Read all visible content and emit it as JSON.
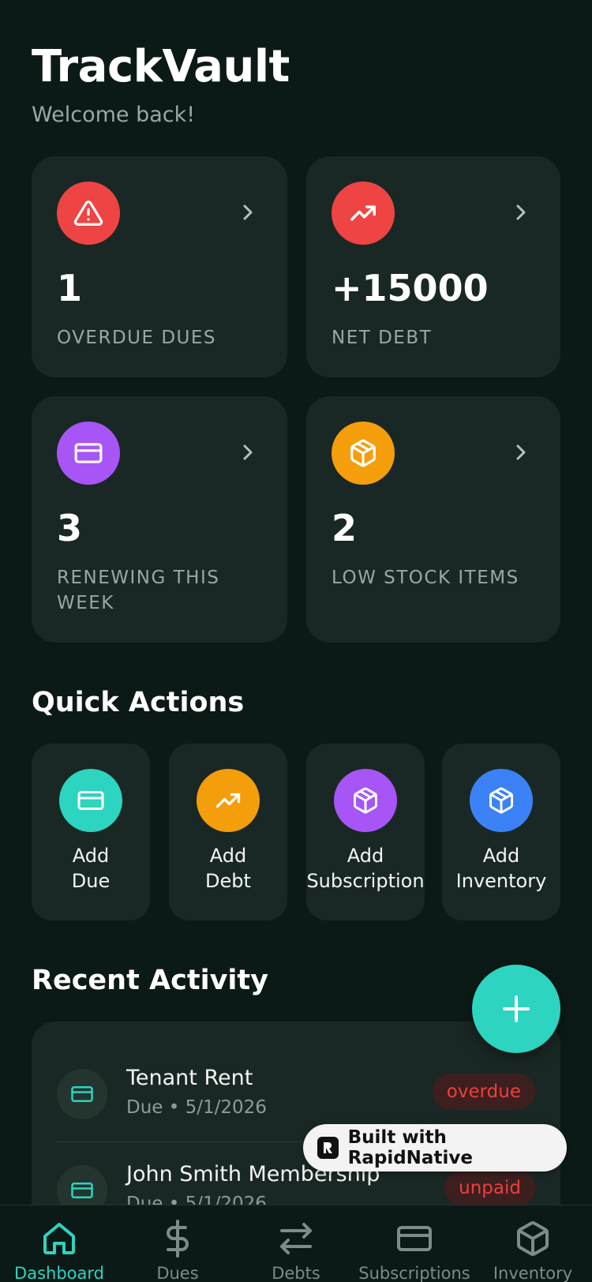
{
  "header": {
    "title": "TrackVault",
    "subtitle": "Welcome back!"
  },
  "stats": [
    {
      "value": "1",
      "label": "OVERDUE DUES",
      "icon": "alert-triangle-icon",
      "color": "#ef4444"
    },
    {
      "value": "+15000",
      "label": "NET DEBT",
      "icon": "trending-up-icon",
      "color": "#ef4444"
    },
    {
      "value": "3",
      "label": "RENEWING THIS WEEK",
      "icon": "credit-card-icon",
      "color": "#a855f7"
    },
    {
      "value": "2",
      "label": "LOW STOCK ITEMS",
      "icon": "package-icon",
      "color": "#f59e0b"
    }
  ],
  "quick_actions": {
    "title": "Quick Actions",
    "items": [
      {
        "label_line1": "Add",
        "label_line2": "Due",
        "icon": "credit-card-icon",
        "color": "#2dd4bf"
      },
      {
        "label_line1": "Add",
        "label_line2": "Debt",
        "icon": "trending-up-icon",
        "color": "#f59e0b"
      },
      {
        "label_line1": "Add",
        "label_line2": "Subscription",
        "icon": "package-icon",
        "color": "#a855f7"
      },
      {
        "label_line1": "Add",
        "label_line2": "Inventory",
        "icon": "package-icon",
        "color": "#3b82f6"
      }
    ]
  },
  "recent_activity": {
    "title": "Recent Activity",
    "items": [
      {
        "title": "Tenant Rent",
        "subtitle": "Due • 5/1/2026",
        "status": "overdue",
        "icon": "credit-card-icon"
      },
      {
        "title": "John Smith Membership",
        "subtitle": "Due • 5/1/2026",
        "status": "unpaid",
        "icon": "credit-card-icon"
      }
    ]
  },
  "fab": {
    "icon": "plus-icon",
    "color": "#2dd4bf"
  },
  "built_with": {
    "text": "Built with RapidNative"
  },
  "tabs": [
    {
      "label": "Dashboard",
      "icon": "home-icon",
      "active": true
    },
    {
      "label": "Dues",
      "icon": "dollar-icon"
    },
    {
      "label": "Debts",
      "icon": "arrows-swap-icon"
    },
    {
      "label": "Subscriptions",
      "icon": "credit-card-icon"
    },
    {
      "label": "Inventory",
      "icon": "package-icon"
    }
  ],
  "colors": {
    "background": "#0c1a17",
    "card": "#1a2825",
    "accent": "#2dd4bf",
    "muted_text": "#9aa7a3",
    "danger": "#ef4444"
  }
}
